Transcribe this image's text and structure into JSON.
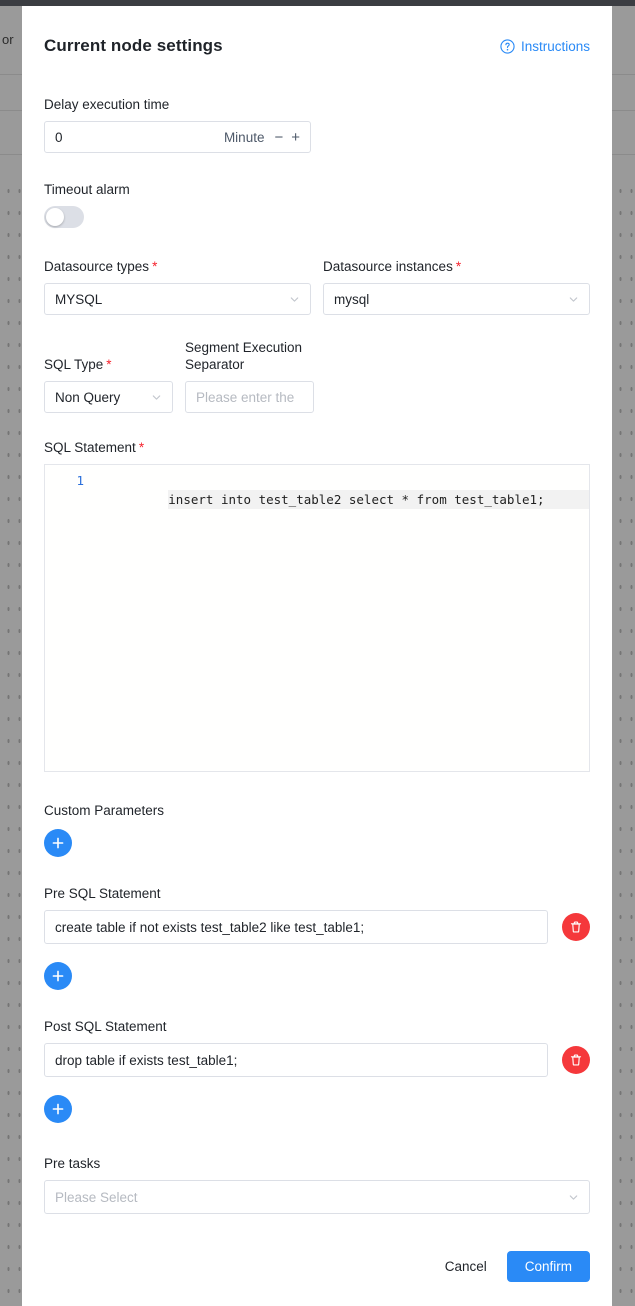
{
  "background": {
    "partial_text": "or"
  },
  "modal": {
    "title": "Current node settings",
    "instructions_label": "Instructions",
    "help_icon": "question-circle-icon"
  },
  "delay": {
    "label": "Delay execution time",
    "value": "0",
    "unit": "Minute",
    "decrement": "−",
    "increment": "+"
  },
  "timeout": {
    "label": "Timeout alarm",
    "enabled": false
  },
  "datasource": {
    "types_label": "Datasource types",
    "types_value": "MYSQL",
    "instances_label": "Datasource instances",
    "instances_value": "mysql",
    "required_mark": "*"
  },
  "sql_type": {
    "label": "SQL Type",
    "value": "Non Query",
    "required_mark": "*"
  },
  "segment_separator": {
    "label": "Segment Execution Separator",
    "placeholder": "Please enter the"
  },
  "sql_statement": {
    "label": "SQL Statement",
    "required_mark": "*",
    "line_number": "1",
    "code": "insert into test_table2 select * from test_table1;"
  },
  "custom_parameters": {
    "label": "Custom Parameters",
    "add_icon": "plus-icon"
  },
  "pre_sql": {
    "label": "Pre SQL Statement",
    "value": "create table if not exists test_table2 like test_table1;",
    "delete_icon": "trash-icon",
    "add_icon": "plus-icon"
  },
  "post_sql": {
    "label": "Post SQL Statement",
    "value": "drop table if exists test_table1;",
    "delete_icon": "trash-icon",
    "add_icon": "plus-icon"
  },
  "pre_tasks": {
    "label": "Pre tasks",
    "placeholder": "Please Select"
  },
  "footer": {
    "cancel_label": "Cancel",
    "confirm_label": "Confirm"
  },
  "colors": {
    "accent": "#2a8af6",
    "danger": "#f5383b",
    "required": "#f5222d",
    "border": "#dcdfe6",
    "text": "#1f2329",
    "placeholder": "#b6bac1"
  }
}
